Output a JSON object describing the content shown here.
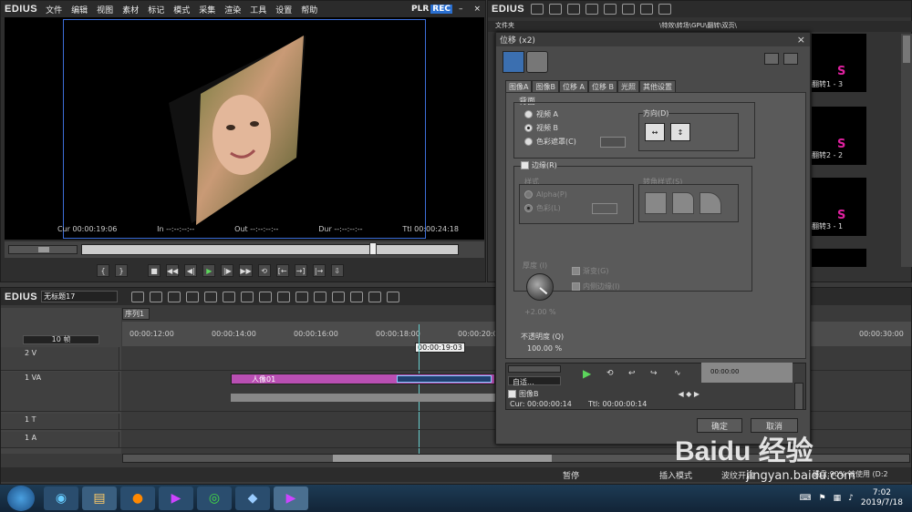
{
  "player": {
    "logo": "EDIUS",
    "menu": [
      "文件",
      "编辑",
      "视图",
      "素材",
      "标记",
      "模式",
      "采集",
      "渲染",
      "工具",
      "设置",
      "帮助"
    ],
    "plr": "PLR",
    "rec": "REC",
    "cur_label": "Cur",
    "cur": "00:00:19:06",
    "in_label": "In",
    "in": "--:--:--:--",
    "out_label": "Out",
    "out": "--:--:--:--",
    "dur_label": "Dur",
    "dur": "--:--:--:--",
    "ttl_label": "Ttl",
    "ttl": "00:00:24:18"
  },
  "bin": {
    "logo": "EDIUS",
    "folder_label": "文件夹",
    "path": "\\特效\\转场\\GPU\\翻转\\双页\\",
    "items": [
      "翻转1 - 3",
      "翻转2 - 2",
      "翻转3 - 1"
    ],
    "letter": "S"
  },
  "dialog": {
    "title": "位移 (x2)",
    "close": "×",
    "tabs": [
      "图像A",
      "图像B",
      "位移 A",
      "位移 B",
      "光照",
      "其他设置"
    ],
    "background": {
      "label": "背面",
      "options": [
        "视频 A",
        "视频 B",
        "色彩遮罩(C)"
      ],
      "selected": 1
    },
    "direction": {
      "label": "方向(D)"
    },
    "border": {
      "label": "边缘(R)",
      "style_label": "样式",
      "style_options": [
        "Alpha(P)",
        "色彩(L)"
      ],
      "corner_label": "转角样式(S)",
      "thickness_label": "厚度 (I)",
      "thickness_value": "+2.00 %",
      "gradient": "渐变(G)",
      "inner": "内侧边缘(I)"
    },
    "opacity": {
      "label": "不透明度 (Q)",
      "value": "100.00 %"
    },
    "mini": {
      "auto": "自适...",
      "track": "图像B",
      "cur": "Cur: 00:00:00:14",
      "ttl": "Ttl: 00:00:00:14",
      "tc": "00:00:00"
    },
    "ok": "确定",
    "cancel": "取消"
  },
  "timeline": {
    "logo": "EDIUS",
    "project": "无标题17",
    "sequence": "序列1",
    "ruler": [
      "00:00:12:00",
      "00:00:14:00",
      "00:00:16:00",
      "00:00:18:00",
      "00:00:20:00",
      "00:00:30:00"
    ],
    "playhead_tc": "00:00:19:03",
    "tracks": [
      "2 V",
      "1 VA",
      "1 T",
      "1 A"
    ],
    "zoom": "10 帧",
    "clip": "人像01",
    "status": [
      "暂停",
      "插入模式",
      "波纹开启",
      "磁盘:90% 被使用 (D:2"
    ]
  },
  "watermark": {
    "text": "Baidu 经验",
    "url": "jingyan.baidu.com"
  },
  "taskbar": {
    "time": "7:02",
    "date": "2019/7/18"
  }
}
